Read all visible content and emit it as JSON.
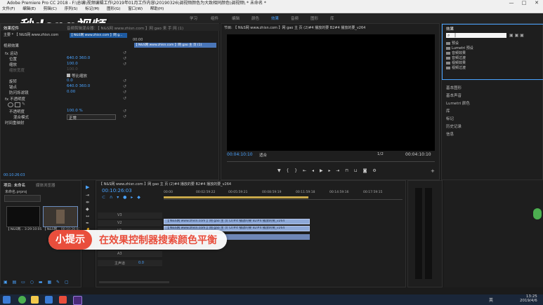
{
  "window": {
    "title": "Adobe Premiere Pro CC 2018 - F:\\总编\\视频编辑工作\\2019年01月工作内容\\20190326\\调视频颜色为大致相同颜色\\调视频\\ * 未命名 *",
    "controls": [
      "—",
      "□",
      "✕"
    ]
  },
  "menu": [
    "文件(F)",
    "编辑(E)",
    "剪辑(C)",
    "序列(S)",
    "标记(M)",
    "图形(G)",
    "窗口(W)",
    "帮助(H)"
  ],
  "workspaces": [
    "学习",
    "组件",
    "编辑",
    "颜色",
    "效果",
    "音频",
    "图形",
    "库"
  ],
  "active_workspace": "效果",
  "logo_text": "秒dong视频",
  "effect_controls": {
    "tabs": [
      "效果控件",
      "Lumetri 范围",
      "音频剪辑混合器：【 N&S网 www.zhisn.com 】网 gao 来 手 网 (1)",
      "【 N&S网 www.zhisn.com 】网 gao 主 页 (1)...",
      "»"
    ],
    "header_left": "主要 * 【 N&S网 www.zhisn.com",
    "header_right": "【 N&S网 www.zhisn.com 】网 g...",
    "section_video": "视频效果",
    "rows": [
      {
        "label": "fx 运动",
        "value": ""
      },
      {
        "label": "位置",
        "value": "640.0     360.0"
      },
      {
        "label": "缩放",
        "value": "100.0"
      },
      {
        "label": "缩放宽度",
        "value": "100.0"
      },
      {
        "label": "等比缩放",
        "value": ""
      },
      {
        "label": "旋转",
        "value": "0.0"
      },
      {
        "label": "锚点",
        "value": "640.0     360.0"
      },
      {
        "label": "防闪烁滤镜",
        "value": "0.00"
      },
      {
        "label": "fx 不透明度",
        "value": ""
      },
      {
        "label": "不透明度",
        "value": "100.0 %"
      },
      {
        "label": "混合模式",
        "value": "正常"
      },
      {
        "label": "时间重映射",
        "value": ""
      }
    ],
    "timecode_mini": "00:00",
    "timecode_bottom": "00:10:26:03",
    "clip_label": "【 N&S网 www.zhisn.com 】网 gao 主 页 (1)"
  },
  "program": {
    "title": "节目: 【 N&S网 www.zhisn.com 】网 gao 主 页 (2)#4 播放的要 B2#4 播放的要_v264",
    "timecode_left": "00:04:10:10",
    "fit": "适合",
    "quality": "1/2",
    "timecode_right": "00:04:10:10"
  },
  "effects_panel": {
    "title": "效果",
    "search_value": "|",
    "tree": [
      "预设",
      "Lumetri 预设",
      "音频效果",
      "音频过渡",
      "视频效果",
      "视频过渡"
    ],
    "side_items": [
      "基本图形",
      "基本声音",
      "Lumetri 颜色",
      "库",
      "标记",
      "历史记录",
      "信息"
    ]
  },
  "project": {
    "tabs": [
      "项目: 未命名",
      "媒体浏览器"
    ],
    "filename": "未命名.prproj",
    "thumb1_label": "【 N&S网... 3:29:10:05",
    "thumb2_label": "【 N&S网... 00:10:26:03"
  },
  "timeline": {
    "tab": "【 N&S网 www.zhisn.com 】网 gao 主 页 (2)#4 播放的要 B2#4 播放的要_v264",
    "timecode": "00:10:26:03",
    "ruler": [
      "00:00",
      "00:02:59:22",
      "00:05:59:21",
      "00:08:59:19",
      "00:11:59:18",
      "00:14:59:16",
      "00:17:59:15",
      "00:20:59:13"
    ],
    "clip_v": "【 N&S网 www.zhisn.com 】网 gao 主 页 (2)#4 播放的要 B2#4 播放的要_v264",
    "clip_a": "【 N&S网 www.zhisn.com 】网 gao 主 页 (2)#4 播放的要 B2#4 播放的要_v264",
    "tracks": [
      "V3",
      "V2",
      "V1",
      "A1",
      "A2",
      "A3",
      "主声道"
    ],
    "master_value": "0.0"
  },
  "tip": {
    "badge": "小提示",
    "text": "在效果控制器搜索颜色平衡"
  },
  "taskbar": {
    "time": "13:25",
    "date": "2019/4/6",
    "tray_text": "英"
  },
  "colors": {
    "accent": "#4aa3ff",
    "tip_red": "#e94e3c",
    "clip": "#8ea9d8"
  }
}
